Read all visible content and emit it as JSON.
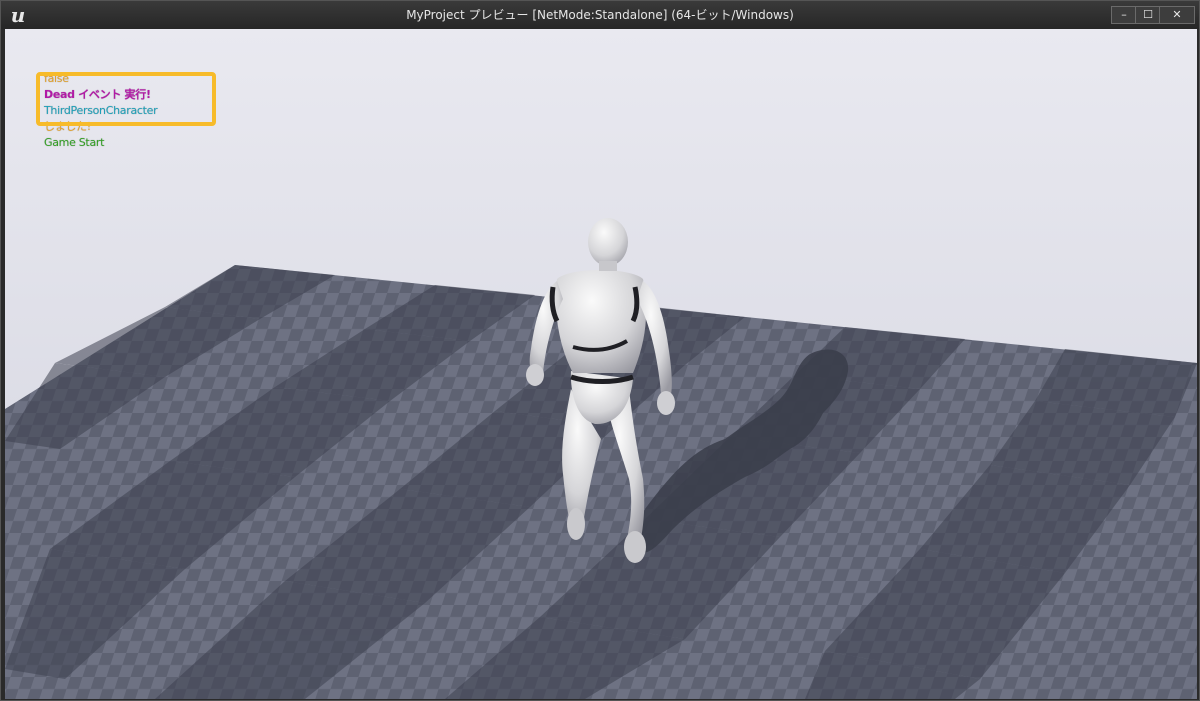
{
  "window": {
    "title": "MyProject プレビュー [NetMode:Standalone]  (64-ビット/Windows)",
    "logo_glyph": "u",
    "controls": {
      "minimize": "–",
      "maximize": "☐",
      "close": "✕"
    }
  },
  "screen_log": {
    "lines": [
      {
        "text": "false",
        "color": "#e2a12a"
      },
      {
        "text": "Dead イベント 実行!",
        "color": "#b21aa6"
      },
      {
        "text": "ThirdPersonCharacter",
        "color": "#1ea0b8"
      },
      {
        "text": "しました!",
        "color": "#e2a12a"
      },
      {
        "text": "Game Start",
        "color": "#33a024"
      }
    ]
  },
  "annotation": {
    "color": "#f7bb2a"
  }
}
